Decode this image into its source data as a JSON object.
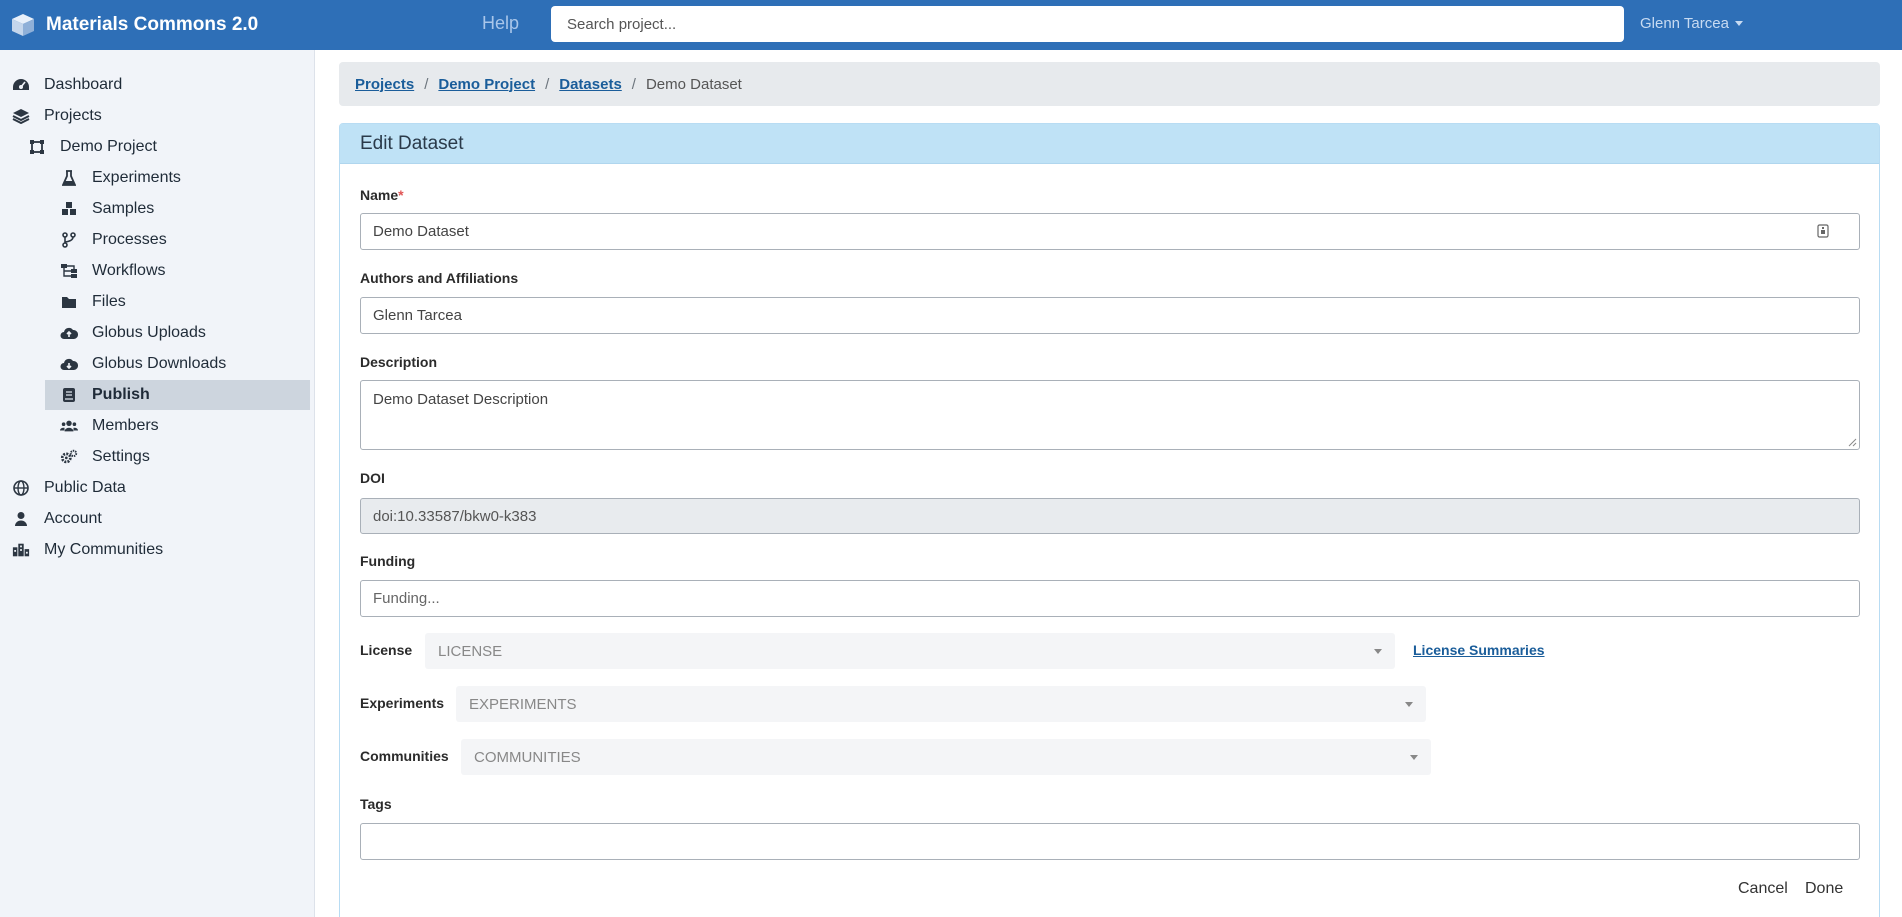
{
  "app": {
    "title": "Materials Commons 2.0",
    "help_label": "Help",
    "search_placeholder": "Search project...",
    "user_name": "Glenn Tarcea",
    "brand_color": "#2e6fb7"
  },
  "sidebar": {
    "items": [
      {
        "label": "Dashboard",
        "icon": "dashboard-icon"
      },
      {
        "label": "Projects",
        "icon": "layers-icon"
      },
      {
        "label": "Demo Project",
        "icon": "project-icon"
      },
      {
        "label": "Experiments",
        "icon": "flask-icon"
      },
      {
        "label": "Samples",
        "icon": "cubes-icon"
      },
      {
        "label": "Processes",
        "icon": "branch-icon"
      },
      {
        "label": "Workflows",
        "icon": "sitemap-icon"
      },
      {
        "label": "Files",
        "icon": "folder-icon"
      },
      {
        "label": "Globus Uploads",
        "icon": "cloud-upload-icon"
      },
      {
        "label": "Globus Downloads",
        "icon": "cloud-download-icon"
      },
      {
        "label": "Publish",
        "icon": "book-icon",
        "active": true
      },
      {
        "label": "Members",
        "icon": "users-icon"
      },
      {
        "label": "Settings",
        "icon": "cogs-icon"
      },
      {
        "label": "Public Data",
        "icon": "globe-icon"
      },
      {
        "label": "Account",
        "icon": "user-icon"
      },
      {
        "label": "My Communities",
        "icon": "city-icon"
      }
    ]
  },
  "breadcrumb": {
    "items": [
      "Projects",
      "Demo Project",
      "Datasets"
    ],
    "current": "Demo Dataset",
    "separator": "/"
  },
  "form": {
    "header": "Edit Dataset",
    "name_label": "Name",
    "required_mark": "*",
    "name_value": "Demo Dataset",
    "authors_label": "Authors and Affiliations",
    "authors_value": "Glenn Tarcea",
    "description_label": "Description",
    "description_value": "Demo Dataset Description",
    "doi_label": "DOI",
    "doi_value": "doi:10.33587/bkw0-k383",
    "funding_label": "Funding",
    "funding_placeholder": "Funding...",
    "license_label": "License",
    "license_placeholder": "LICENSE",
    "license_summaries_link": "License Summaries",
    "experiments_label": "Experiments",
    "experiments_placeholder": "EXPERIMENTS",
    "communities_label": "Communities",
    "communities_placeholder": "COMMUNITIES",
    "tags_label": "Tags",
    "cancel_label": "Cancel",
    "done_label": "Done"
  }
}
